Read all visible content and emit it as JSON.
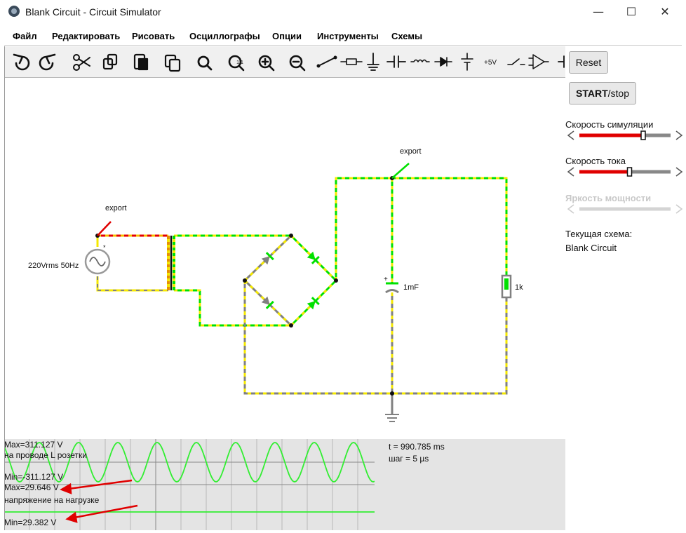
{
  "window": {
    "title": "Blank Circuit - Circuit Simulator",
    "minimize": "—",
    "maximize": "☐",
    "close": "✕"
  },
  "menu": {
    "items": [
      "Файл",
      "Редактировать",
      "Рисовать",
      "Осциллографы",
      "Опции",
      "Инструменты",
      "Схемы"
    ]
  },
  "toolbar": {
    "icons": [
      "undo-icon",
      "redo-icon",
      "cut-icon",
      "copy-icon",
      "paste-icon",
      "duplicate-icon",
      "search-icon",
      "zoom-100-icon",
      "zoom-in-icon",
      "zoom-out-icon",
      "wire-icon",
      "resistor-icon",
      "ground-icon",
      "capacitor-icon",
      "inductor-icon",
      "diode-icon",
      "battery-icon",
      "voltage-rail-icon",
      "switch-icon",
      "opamp-icon",
      "transistor-icon"
    ],
    "voltage_label": "+5V"
  },
  "sidebar": {
    "reset_label": "Reset",
    "start_bold": "START",
    "start_rest": "/stop",
    "sim_speed_label": "Скорость симуляции",
    "sim_speed_value": 0.7,
    "current_speed_label": "Скорость тока",
    "current_speed_value": 0.55,
    "power_brightness_label": "Яркость мощности",
    "current_circuit_label": "Текущая схема:",
    "current_circuit_name": "Blank Circuit"
  },
  "circuit": {
    "source_label": "220Vrms 50Hz",
    "export_left": "export",
    "export_right": "export",
    "capacitor_label": "1mF",
    "resistor_label": "1k",
    "plus_sign": "+",
    "star": "*"
  },
  "scope": {
    "max1": "Max=311.127 V",
    "desc1": "на проводе L розетки",
    "min1": "Min=-311.127 V",
    "max2": "Max=29.646 V",
    "desc2": "напряжение на нагрузке",
    "min2": "Min=29.382 V",
    "time": "t = 990.785 ms",
    "step": "шаг = 5 µs"
  },
  "colors": {
    "wire_green": "#00e000",
    "wire_yellow": "#f5e800",
    "wire_gray": "#808080",
    "slider_red": "#e00000",
    "arrow_red": "#e00000",
    "scope_wave": "#33ee33"
  }
}
